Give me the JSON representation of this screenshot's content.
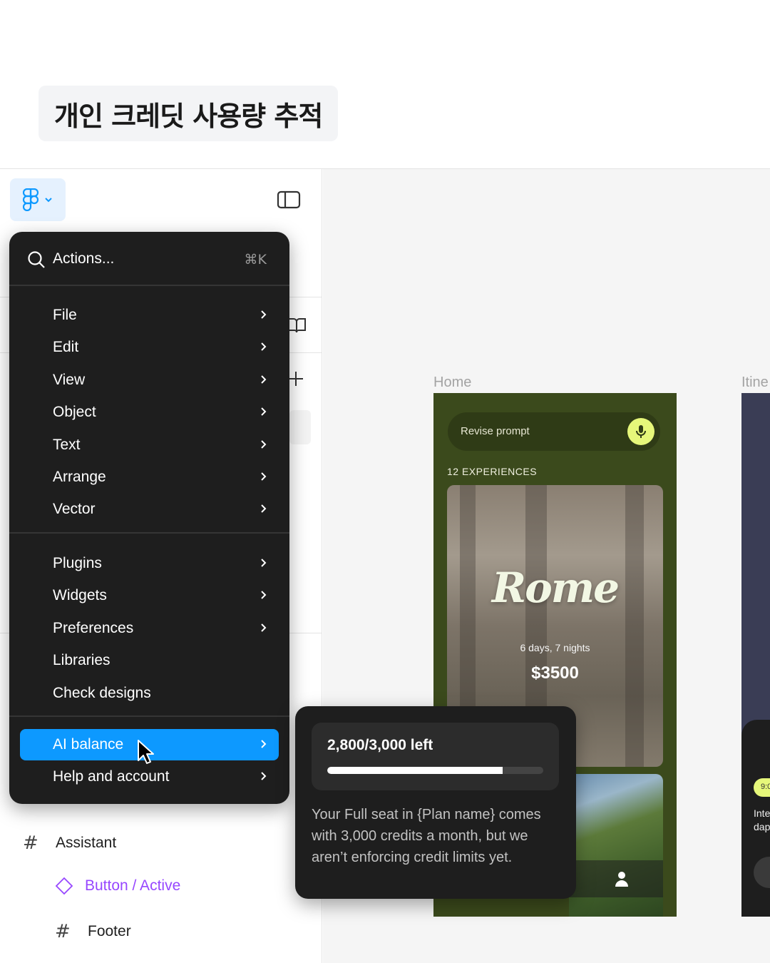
{
  "heading": "개인 크레딧 사용량 추적",
  "menu": {
    "search_label": "Actions...",
    "shortcut": "⌘K",
    "groups": [
      [
        {
          "label": "File",
          "submenu": true
        },
        {
          "label": "Edit",
          "submenu": true
        },
        {
          "label": "View",
          "submenu": true
        },
        {
          "label": "Object",
          "submenu": true
        },
        {
          "label": "Text",
          "submenu": true
        },
        {
          "label": "Arrange",
          "submenu": true
        },
        {
          "label": "Vector",
          "submenu": true
        }
      ],
      [
        {
          "label": "Plugins",
          "submenu": true
        },
        {
          "label": "Widgets",
          "submenu": true
        },
        {
          "label": "Preferences",
          "submenu": true
        },
        {
          "label": "Libraries",
          "submenu": false
        },
        {
          "label": "Check designs",
          "submenu": false
        }
      ],
      [
        {
          "label": "AI balance",
          "submenu": true,
          "active": true
        },
        {
          "label": "Help and account",
          "submenu": true
        }
      ]
    ]
  },
  "credits": {
    "text": "2,800/3,000 left",
    "fraction_left": 0.8133,
    "description": "Your Full seat in {Plan name} comes with 3,000 credits a month, but we aren’t enforcing credit limits yet."
  },
  "layers": {
    "assistant": "Assistant",
    "button_active": "Button / Active",
    "footer": "Footer"
  },
  "canvas": {
    "home_label": "Home",
    "itinerary_label": "Itine",
    "prompt_placeholder": "Revise prompt",
    "experiences": "12 EXPERIENCES",
    "rome_title": "Rome",
    "rome_duration": "6 days, 7 nights",
    "rome_price": "$3500",
    "itin_chip": "9:0",
    "itin_text_1": "Inte",
    "itin_text_2": "dap"
  },
  "colors": {
    "accent": "#0d99ff",
    "menu_bg": "#1e1e1e",
    "component_purple": "#9747ff",
    "home_bg": "#3b4a1c",
    "mic_yellow": "#e6f77a"
  }
}
